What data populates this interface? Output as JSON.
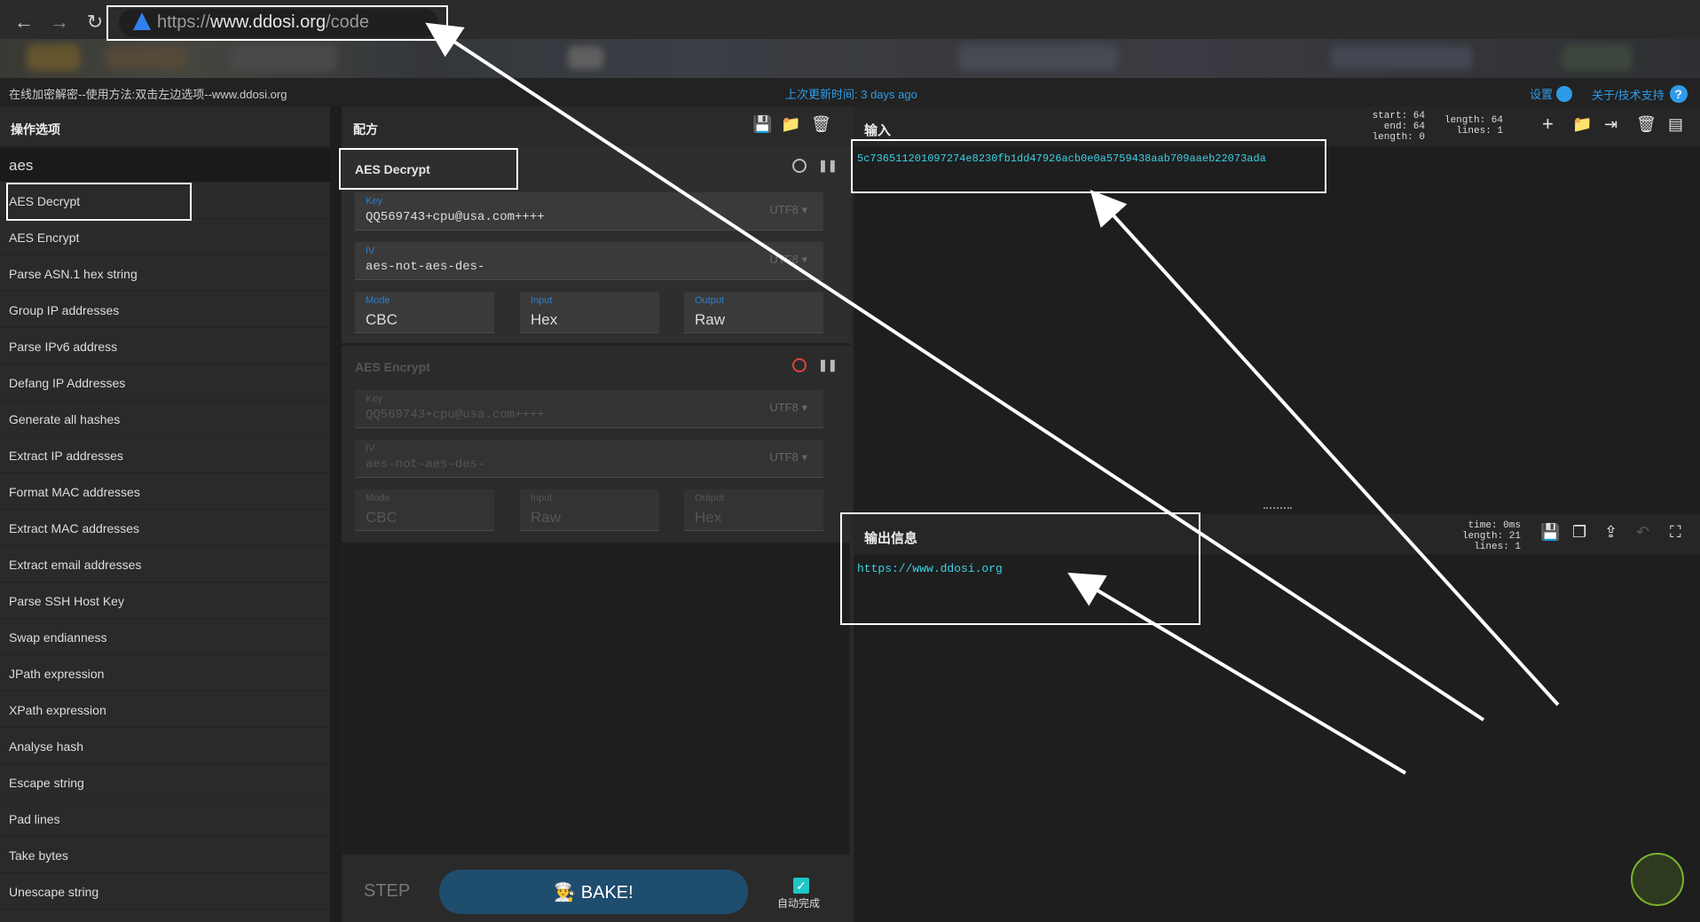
{
  "browser": {
    "url_prefix": "https://",
    "url_domain": "www.ddosi.org",
    "url_path": "/code"
  },
  "info_bar": {
    "left_text": "在线加密解密--使用方法:双击左边选项--www.ddosi.org",
    "center_text": "上次更新时间: 3 days ago",
    "settings_label": "设置",
    "about_label": "关于/技术支持",
    "help_glyph": "?"
  },
  "operations": {
    "title": "操作选项",
    "search_value": "aes",
    "items": [
      "AES Decrypt",
      "AES Encrypt",
      "Parse ASN.1 hex string",
      "Group IP addresses",
      "Parse IPv6 address",
      "Defang IP Addresses",
      "Generate all hashes",
      "Extract IP addresses",
      "Format MAC addresses",
      "Extract MAC addresses",
      "Extract email addresses",
      "Parse SSH Host Key",
      "Swap endianness",
      "JPath expression",
      "XPath expression",
      "Analyse hash",
      "Escape string",
      "Pad lines",
      "Take bytes",
      "Unescape string"
    ]
  },
  "recipe": {
    "title": "配方",
    "cards": [
      {
        "title": "AES Decrypt",
        "key_label": "Key",
        "key_value": "QQ569743+cpu@usa.com++++",
        "key_enc": "UTF8 ▾",
        "iv_label": "IV",
        "iv_value": "aes-not-aes-des-",
        "iv_enc": "UTF8 ▾",
        "mode_label": "Mode",
        "mode_value": "CBC",
        "input_label": "Input",
        "input_value": "Hex",
        "output_label": "Output",
        "output_value": "Raw"
      },
      {
        "title": "AES Encrypt",
        "key_label": "Key",
        "key_value": "QQ569743+cpu@usa.com++++",
        "key_enc": "UTF8 ▾",
        "iv_label": "IV",
        "iv_value": "aes-not-aes-des-",
        "iv_enc": "UTF8 ▾",
        "mode_label": "Mode",
        "mode_value": "CBC",
        "input_label": "Input",
        "input_value": "Raw",
        "output_label": "Output",
        "output_value": "Hex"
      }
    ],
    "step_label": "STEP",
    "bake_label": "BAKE!",
    "auto_bake_label": "自动完成"
  },
  "input": {
    "title": "输入",
    "stats_left": [
      "start: 64",
      "end: 64",
      "length: 0"
    ],
    "stats_right": [
      "length: 64",
      "lines: 1"
    ],
    "value": "5c736511201097274e8230fb1dd47926acb0e0a5759438aab709aaeb22073ada"
  },
  "output": {
    "title": "输出信息",
    "stats": [
      "time: 0ms",
      "length: 21",
      "lines: 1"
    ],
    "value": "https://www.ddosi.org"
  },
  "colors": {
    "accent": "#2f9be8",
    "output_text": "#3ad1e6",
    "bake_button": "#1f4d6e",
    "disabled_icon": "#e04040"
  }
}
